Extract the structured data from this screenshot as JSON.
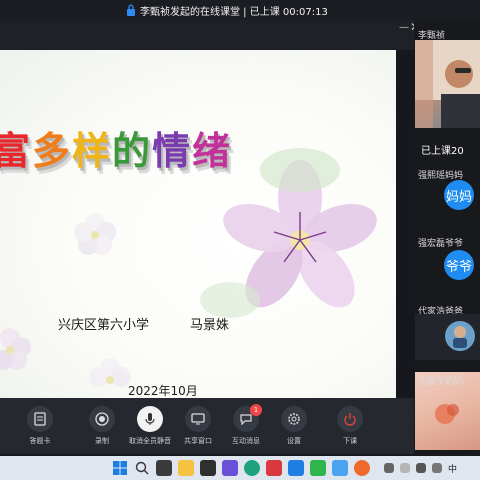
{
  "window": {
    "title": "李甄祯发起的在线课堂 | 已上课 00:07:13"
  },
  "slide": {
    "title_chars": [
      "富",
      "多",
      "样",
      "的",
      "情",
      "绪"
    ],
    "title_colors": [
      "#e8262b",
      "#f07d1c",
      "#f0b417",
      "#3a9a3a",
      "#7a3bb0",
      "#c2309a"
    ],
    "school": "兴庆区第六小学",
    "teacher": "马景姝",
    "date": "2022年10月"
  },
  "sidebar": {
    "host_name": "李甄祯",
    "on_class_count": "已上课20",
    "participants": [
      {
        "name": "强熙瑶妈妈",
        "avatar_text": "妈妈"
      },
      {
        "name": "强宏磊爷爷",
        "avatar_text": "爷爷"
      },
      {
        "name": "代家浩爸爸",
        "avatar_text": ""
      },
      {
        "name": "闫嘉宇奶奶",
        "avatar_text": ""
      }
    ]
  },
  "toolbar": {
    "buttons": [
      {
        "label": "答题卡",
        "icon": "answer-card-icon"
      },
      {
        "label": "录制",
        "icon": "record-icon"
      },
      {
        "label": "取消全员静音",
        "icon": "unmute-all-icon"
      },
      {
        "label": "共享窗口",
        "icon": "share-window-icon"
      },
      {
        "label": "互动消息",
        "icon": "chat-icon",
        "badge": "1"
      },
      {
        "label": "设置",
        "icon": "settings-icon"
      },
      {
        "label": "下课",
        "icon": "end-class-icon"
      }
    ]
  },
  "taskbar": {
    "tray_text": "中"
  },
  "colors": {
    "accent": "#1e8cf0",
    "end_class": "#e0443a",
    "badge": "#f04646"
  }
}
